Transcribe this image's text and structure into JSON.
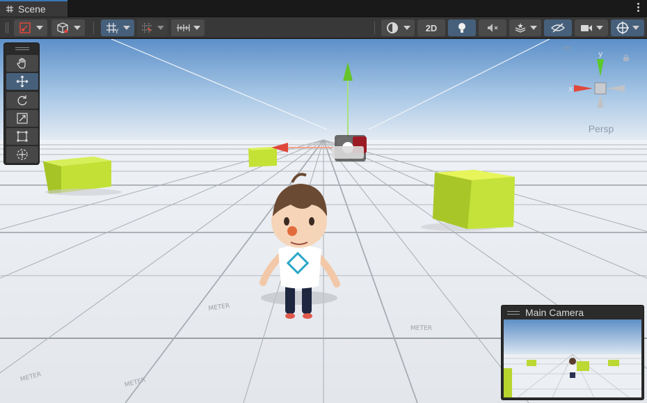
{
  "window": {
    "tab_title": "Scene",
    "tab_icon": "grid-hash-icon",
    "menu_icon": "kebab-menu-icon"
  },
  "toolbar": {
    "mode_2d_label": "2D",
    "icons": [
      "gizmo-toggle-icon",
      "shaded-cube-icon",
      "grid-snap-icon",
      "increment-snap-icon",
      "ruler-icon",
      "draw-mode-icon",
      "lighting-icon",
      "audio-mute-icon",
      "effects-icon",
      "hidden-objects-icon",
      "camera-icon",
      "gizmos-icon"
    ]
  },
  "tools": {
    "items": [
      {
        "name": "hand-tool",
        "icon": "hand-icon",
        "active": false
      },
      {
        "name": "move-tool",
        "icon": "move-arrows-icon",
        "active": true
      },
      {
        "name": "rotate-tool",
        "icon": "rotate-icon",
        "active": false
      },
      {
        "name": "scale-tool",
        "icon": "scale-icon",
        "active": false
      },
      {
        "name": "rect-tool",
        "icon": "rect-transform-icon",
        "active": false
      },
      {
        "name": "transform-tool",
        "icon": "transform-icon",
        "active": false
      }
    ]
  },
  "gizmo": {
    "projection_label": "Persp",
    "axis_y_label": "y",
    "axis_x_label": "x",
    "lock_icon": "lock-icon"
  },
  "camera_preview": {
    "title": "Main Camera"
  },
  "floor_label": "METER",
  "colors": {
    "accent_blue": "#46607c",
    "tab_highlight": "#3a79bb",
    "cube_green": "#c6e53a",
    "axis_red": "#e0483c",
    "axis_green": "#7cd23a"
  }
}
